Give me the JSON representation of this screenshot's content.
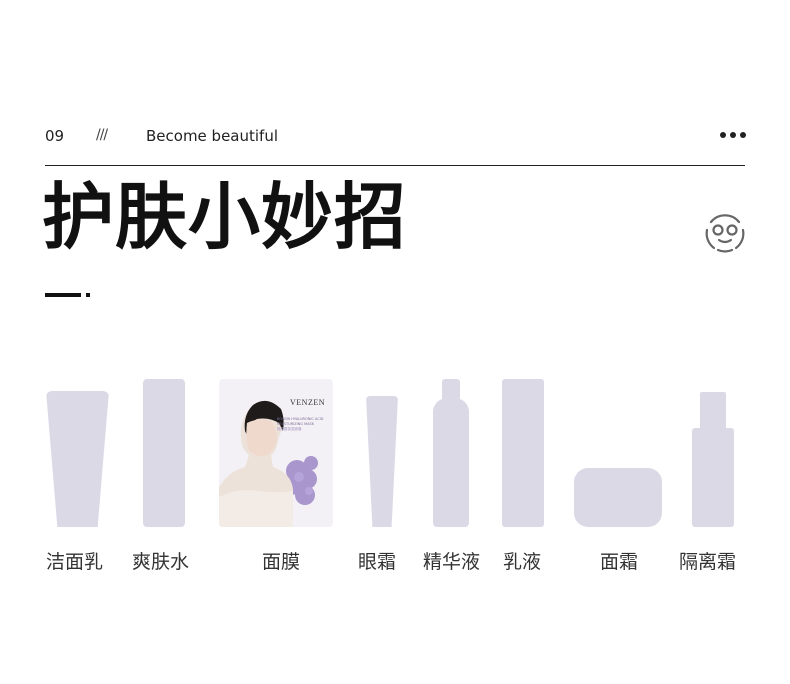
{
  "header": {
    "number": "09",
    "slashes": "///",
    "subtitle": "Become beautiful",
    "more_icon": "more-dots-icon"
  },
  "title": "护肤小妙招",
  "face_icon": "face-mask-icon",
  "mask_product": {
    "brand": "VENZEN",
    "line1": "BOSEIN HYALURONIC ACID",
    "line2": "MOISTURIZING MASK",
    "line3": "玻尿酸保湿面膜"
  },
  "products": [
    {
      "label": "洁面乳",
      "icon": "cleanser-tube"
    },
    {
      "label": "爽肤水",
      "icon": "toner-bottle"
    },
    {
      "label": "面膜",
      "icon": "face-mask-pack"
    },
    {
      "label": "眼霜",
      "icon": "eye-cream-tube"
    },
    {
      "label": "精华液",
      "icon": "serum-bottle"
    },
    {
      "label": "乳液",
      "icon": "lotion-bottle"
    },
    {
      "label": "面霜",
      "icon": "cream-jar"
    },
    {
      "label": "隔离霜",
      "icon": "primer-bottle"
    }
  ],
  "colors": {
    "product_shape": "#dcd9e6",
    "text": "#111111",
    "mask_flower": "#9b87c7"
  }
}
